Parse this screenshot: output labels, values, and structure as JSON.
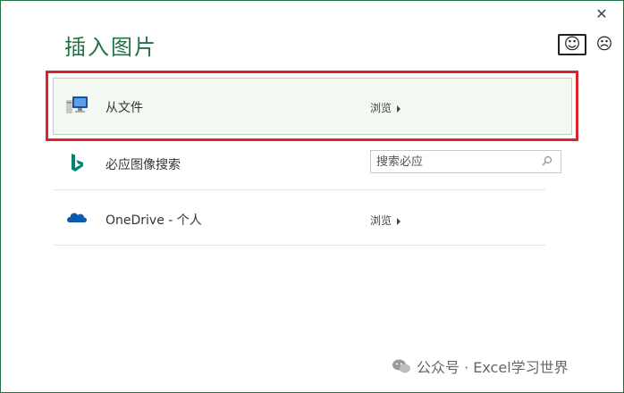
{
  "window": {
    "close_glyph": "✕"
  },
  "title": "插入图片",
  "feedback": {
    "smile_glyph": "☺",
    "frown_glyph": "☹"
  },
  "highlight_color": "#d9232e",
  "accent_color": "#217346",
  "sources": [
    {
      "label": "从文件",
      "icon": "computer-icon",
      "action_label": "浏览"
    },
    {
      "label": "必应图像搜索",
      "icon": "bing-logo-icon",
      "search_placeholder": "搜索必应"
    },
    {
      "label": "OneDrive - 个人",
      "icon": "onedrive-cloud-icon",
      "action_label": "浏览"
    }
  ],
  "watermark": "公众号 · Excel学习世界"
}
